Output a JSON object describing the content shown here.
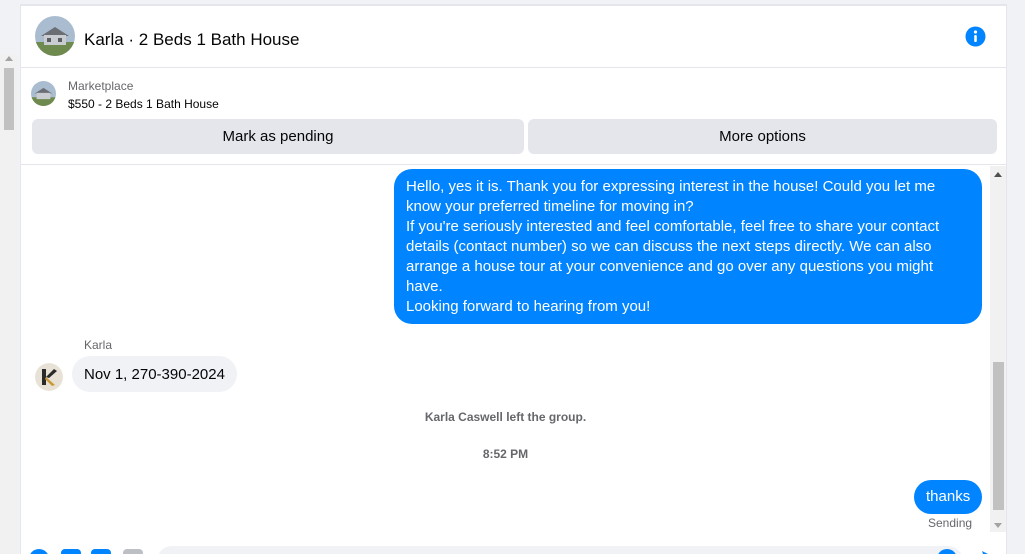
{
  "header": {
    "title": "Karla · 2 Beds 1 Bath House"
  },
  "listing": {
    "kicker": "Marketplace",
    "price_title": "$550 - 2 Beds 1 Bath House",
    "mark_pending_label": "Mark as pending",
    "more_options_label": "More options"
  },
  "messages": {
    "outgoing_1": {
      "line1": "Hello, yes it is. Thank you for expressing interest in the house! Could you let me know your preferred timeline for moving in?",
      "line2": "If you're seriously interested and feel comfortable, feel free to share your contact details (contact number) so we can discuss the next steps directly. We can also arrange a house tour at your convenience and go over any questions you might have.",
      "line3": "Looking forward to hearing from you!"
    },
    "incoming_sender": "Karla",
    "incoming_1": "Nov 1, 270-390-2024",
    "system_left": "Karla Caswell left the group.",
    "timestamp": "8:52 PM",
    "outgoing_2": "thanks",
    "status": "Sending"
  },
  "colors": {
    "accent": "#0084ff",
    "bubble_in": "#f0f2f5",
    "button": "#e4e6eb"
  },
  "icons": {
    "info": "info-icon",
    "send": "send-icon"
  }
}
